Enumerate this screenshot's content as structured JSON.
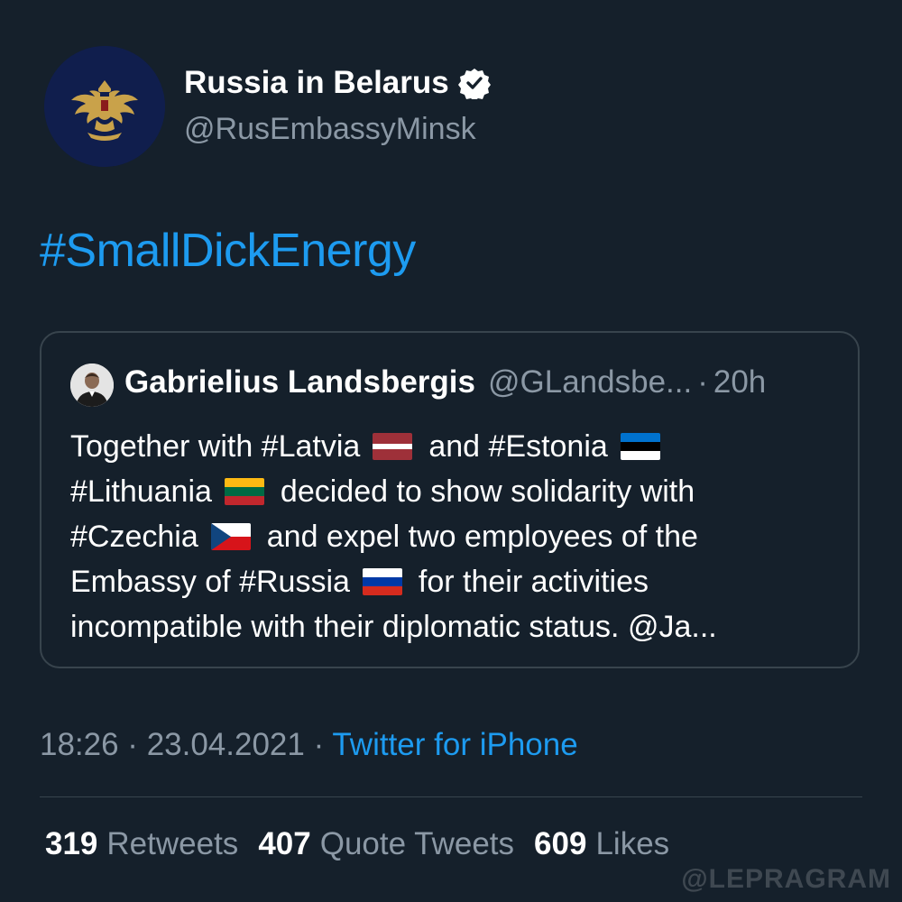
{
  "tweet": {
    "author": {
      "name": "Russia in Belarus",
      "handle": "@RusEmbassyMinsk",
      "verified_icon": "verified-badge-icon",
      "avatar_icon": "double-headed-eagle-emblem"
    },
    "text": "#SmallDickEnergy",
    "timestamp": "18:26 · 23.04.2021 · ",
    "source": "Twitter for iPhone",
    "stats": [
      {
        "count": "319",
        "label": "Retweets"
      },
      {
        "count": "407",
        "label": "Quote Tweets"
      },
      {
        "count": "609",
        "label": "Likes"
      }
    ]
  },
  "quoted": {
    "name": "Gabrielius Landsbergis",
    "handle": "@GLandsbe...",
    "separator": "·",
    "time": "20h",
    "lines": [
      {
        "before": "Together with #Latvia",
        "flag": "latvia-flag",
        "after": "and #Estonia",
        "trailing_flag": "estonia-flag"
      },
      {
        "before": "#Lithuania",
        "flag": "lithuania-flag",
        "after": "decided to show solidarity with"
      },
      {
        "before": "#Czechia",
        "flag": "czechia-flag",
        "after": "and expel two employees of the"
      },
      {
        "before": "Embassy of #Russia",
        "flag": "russia-flag",
        "after": "for their activities"
      },
      {
        "before": "incompatible with their diplomatic status. @Ja..."
      }
    ]
  },
  "watermark": "@LEPRAGRAM",
  "colors": {
    "background": "#15202b",
    "link": "#1d9bf0",
    "muted": "#8b98a5",
    "border": "#38444d"
  }
}
